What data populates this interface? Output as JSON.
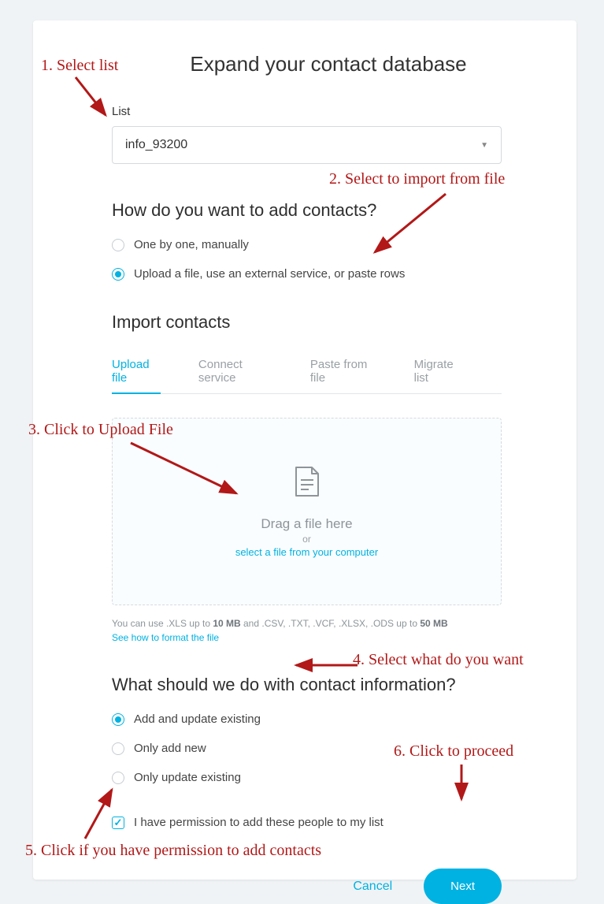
{
  "page": {
    "title": "Expand your contact database"
  },
  "list": {
    "label": "List",
    "value": "info_93200"
  },
  "addMethod": {
    "heading": "How do you want to add contacts?",
    "options": [
      {
        "label": "One by one, manually",
        "selected": false
      },
      {
        "label": "Upload a file, use an external service, or paste rows",
        "selected": true
      }
    ]
  },
  "import": {
    "heading": "Import contacts",
    "tabs": [
      {
        "label": "Upload file",
        "active": true
      },
      {
        "label": "Connect service",
        "active": false
      },
      {
        "label": "Paste from file",
        "active": false
      },
      {
        "label": "Migrate list",
        "active": false
      }
    ],
    "dropzone": {
      "dragText": "Drag a file here",
      "orText": "or",
      "selectLink": "select a file from your computer"
    },
    "helpText": {
      "t1": "You can use .XLS up to ",
      "b1": "10 MB",
      "t2": " and .CSV, .TXT, .VCF, .XLSX, .ODS up to ",
      "b2": "50 MB"
    },
    "helpLink": "See how to format the file"
  },
  "contactAction": {
    "heading": "What should we do with contact information?",
    "options": [
      {
        "label": "Add and update existing",
        "selected": true
      },
      {
        "label": "Only add new",
        "selected": false
      },
      {
        "label": "Only update existing",
        "selected": false
      }
    ]
  },
  "permission": {
    "label": "I have permission to add these people to my list",
    "checked": true
  },
  "buttons": {
    "cancel": "Cancel",
    "next": "Next"
  },
  "annotations": {
    "a1": "1. Select list",
    "a2": "2. Select to import from file",
    "a3": "3. Click to Upload File",
    "a4": "4. Select what do you want",
    "a5": "5. Click if you have permission to add contacts",
    "a6": "6. Click to proceed"
  }
}
